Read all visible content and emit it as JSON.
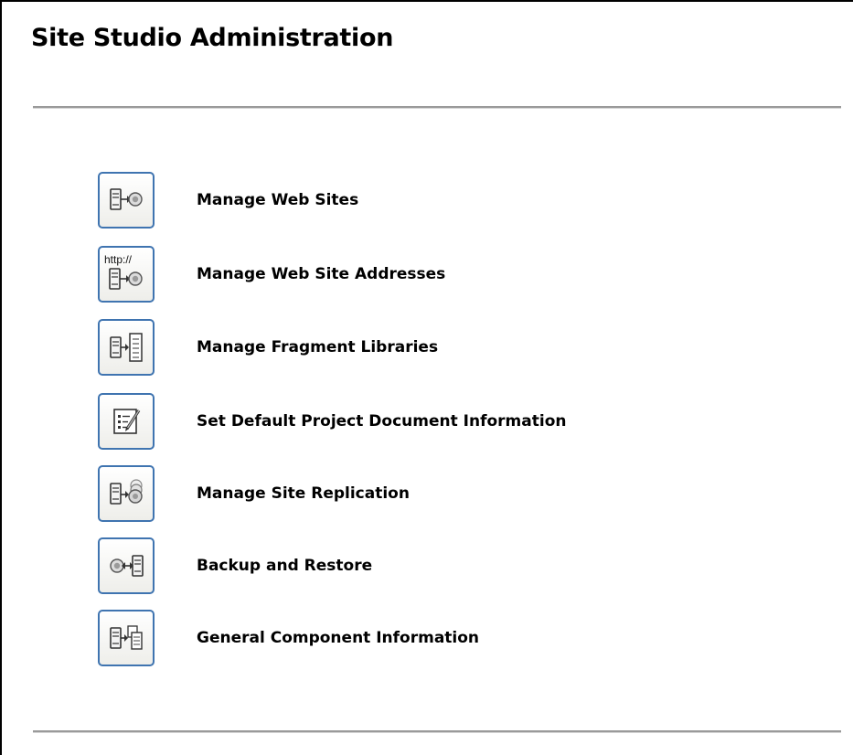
{
  "page": {
    "title": "Site Studio Administration"
  },
  "menu": {
    "items": [
      {
        "label": "Manage Web Sites",
        "icon": "server-arrow-globe-icon"
      },
      {
        "label": "Manage Web Site Addresses",
        "icon": "http-server-globe-icon",
        "icon_text": "http://"
      },
      {
        "label": "Manage Fragment Libraries",
        "icon": "server-arrow-document-icon"
      },
      {
        "label": "Set Default Project Document Information",
        "icon": "document-edit-icon"
      },
      {
        "label": "Manage Site Replication",
        "icon": "server-replication-icon"
      },
      {
        "label": "Backup and Restore",
        "icon": "backup-restore-icon"
      },
      {
        "label": "General Component Information",
        "icon": "server-arrow-components-icon"
      }
    ]
  },
  "colors": {
    "icon_border": "#3f74b0",
    "rule": "#9a9a9a"
  }
}
